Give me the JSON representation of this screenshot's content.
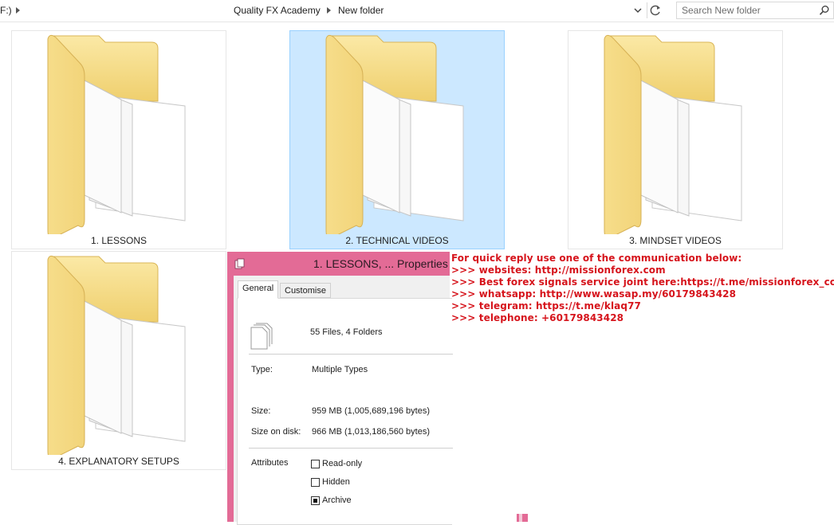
{
  "address_bar": {
    "drive_fragment": "F:)",
    "breadcrumbs": [
      "Quality FX Academy",
      "New folder"
    ],
    "search_placeholder": "Search New folder"
  },
  "folders": [
    {
      "label": "1. LESSONS",
      "selected": false
    },
    {
      "label": "2. TECHNICAL VIDEOS",
      "selected": true
    },
    {
      "label": "3. MINDSET VIDEOS",
      "selected": false
    },
    {
      "label": "4. EXPLANATORY SETUPS",
      "selected": false
    }
  ],
  "properties_dialog": {
    "title": "1. LESSONS, ... Properties",
    "tabs": [
      "General",
      "Customise"
    ],
    "active_tab": "General",
    "summary": "55 Files, 4 Folders",
    "type_label": "Type:",
    "type_value": "Multiple Types",
    "size_label": "Size:",
    "size_value": "959 MB (1,005,689,196 bytes)",
    "size_on_disk_label": "Size on disk:",
    "size_on_disk_value": "966 MB (1,013,186,560 bytes)",
    "attributes_label": "Attributes",
    "attributes": [
      {
        "label": "Read-only",
        "checked": false
      },
      {
        "label": "Hidden",
        "checked": false
      },
      {
        "label": "Archive",
        "checked": true
      }
    ]
  },
  "overlay_text": [
    "For quick reply use one of the communication below:",
    ">>> websites: http://missionforex.com",
    ">>> Best forex signals service joint here:https://t.me/missionforex_com",
    ">>> whatsapp: http://www.wasap.my/60179843428",
    ">>> telegram: https://t.me/klaq77",
    ">>> telephone: +60179843428"
  ],
  "colors": {
    "dialog_frame": "#e36b96",
    "overlay_text": "#d6141c",
    "selection_bg": "#cce8ff",
    "selection_border": "#99d1ff"
  }
}
